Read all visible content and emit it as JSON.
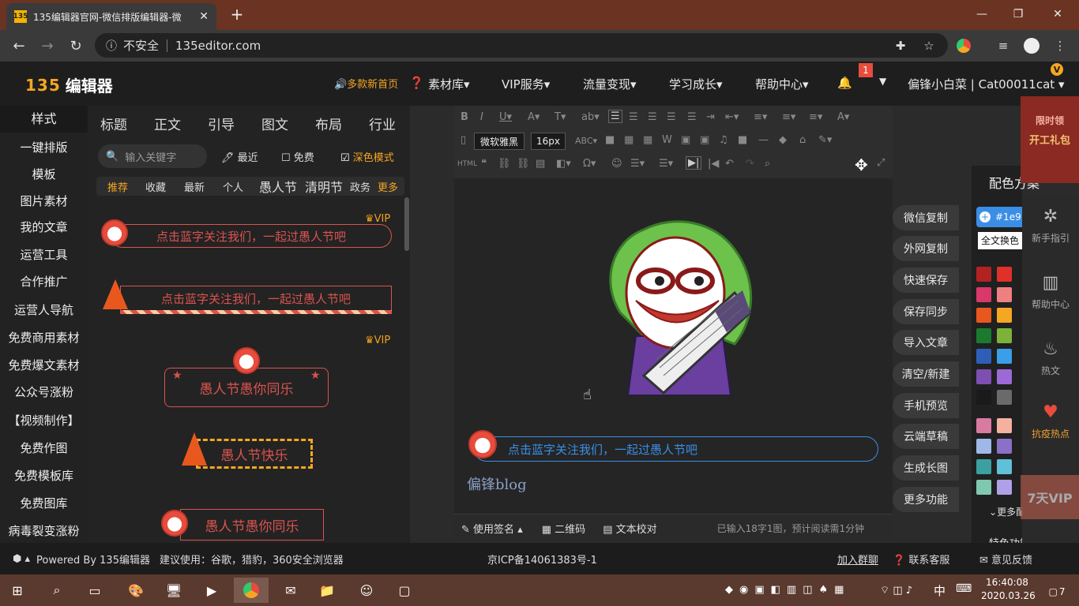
{
  "browser": {
    "tab_title": "135编辑器官网-微信排版编辑器-微",
    "tab_close": "✕",
    "new_tab": "+",
    "insecure": "不安全",
    "url": "135editor.com",
    "nav_back": "←",
    "nav_forward": "→",
    "nav_reload": "↻"
  },
  "header": {
    "logo_num": "135",
    "logo_text": "编辑器",
    "nav": [
      "🔊多款新首页",
      "素材库▾",
      "VIP服务▾",
      "流量变现▾",
      "学习成长▾",
      "帮助中心▾"
    ],
    "notification_count": "1",
    "user": "偏锋小白菜 | Cat00011cat ▾",
    "vip_badge": "V"
  },
  "left_sidebar": {
    "items": [
      "样式",
      "一键排版",
      "模板",
      "图片素材",
      "我的文章",
      "运营工具",
      "合作推广",
      "运营人导航",
      "免费商用素材",
      "免费爆文素材",
      "公众号涨粉",
      "【视频制作】",
      "免费作图",
      "免费模板库",
      "免费图库",
      "病毒裂变涨粉"
    ]
  },
  "panel": {
    "categories": [
      "标题",
      "正文",
      "引导",
      "图文",
      "布局",
      "行业"
    ],
    "search_placeholder": "输入关键字",
    "options": [
      "最近",
      "免费",
      "深色模式"
    ],
    "subtabs": [
      "推荐",
      "收藏",
      "最新",
      "个人",
      "愚人节",
      "清明节",
      "政务",
      "更多"
    ],
    "vip": "VIP",
    "templates": [
      "点击蓝字关注我们，一起过愚人节吧",
      "点击蓝字关注我们，一起过愚人节吧",
      "愚人节愚你同乐",
      "愚人节快乐",
      "愚人节愚你同乐"
    ]
  },
  "editor": {
    "font": "微软雅黑",
    "size": "16px",
    "follow_text": "点击蓝字关注我们，一起过愚人节吧",
    "blog_text": "偏锋blog",
    "footer": {
      "signature": "使用签名",
      "qrcode": "二维码",
      "proofread": "文本校对",
      "status": "已输入18字1图，预计阅读需1分钟"
    }
  },
  "actions": [
    "微信复制",
    "外网复制",
    "快速保存",
    "保存同步",
    "导入文章",
    "清空/新建",
    "手机预览",
    "云端草稿",
    "生成长图",
    "更多功能"
  ],
  "color_scheme": {
    "title": "配色方案",
    "hex": "#1e9",
    "replace_label": "全文换色",
    "more": "更多配色",
    "feature": "特色功能",
    "swatches": [
      "#b22222",
      "#e0302a",
      "#d9386b",
      "#f08080",
      "#e8581e",
      "#f5a623",
      "#1b7a2e",
      "#7bb33a",
      "#2d5fb8",
      "#3a9ee8",
      "#7c4fb0",
      "#9b6ad6",
      "#1a1a1a",
      "#6a6a6a",
      "#d97aa0",
      "#f5b0a0",
      "#a0b8e8",
      "#8a70c8",
      "#3aa0a0",
      "#60c0d8",
      "#80c8b0",
      "#b0a0e8"
    ]
  },
  "right_tools": {
    "promo": [
      "限时领",
      "开工礼包"
    ],
    "items": [
      "新手指引",
      "帮助中心",
      "热文",
      "抗疫热点"
    ],
    "seven_day": "7天VIP"
  },
  "footer": {
    "powered": "Powered By 135编辑器",
    "suggest": "建议使用：谷歌，猎豹，360安全浏览器",
    "icp": "京ICP备14061383号-1",
    "join": "加入群聊",
    "service": "联系客服",
    "feedback": "意见反馈"
  },
  "taskbar": {
    "time": "16:40:08",
    "date": "2020.03.26",
    "ime": "中",
    "notif_count": "7"
  }
}
